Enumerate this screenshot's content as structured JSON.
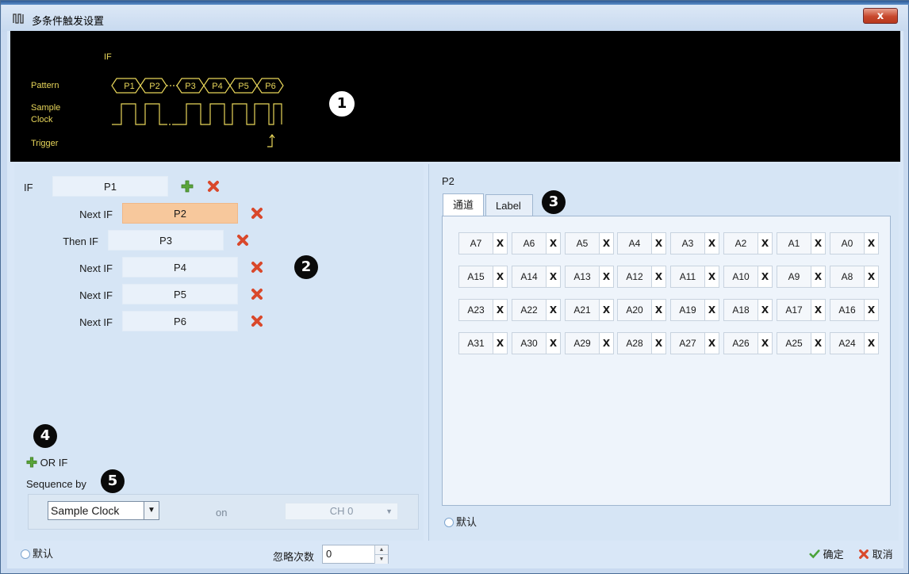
{
  "window": {
    "title": "多条件触发设置",
    "close_label": "x"
  },
  "scope": {
    "if_label": "IF",
    "pattern_label": "Pattern",
    "sample_label": "Sample",
    "clock_label": "Clock",
    "trigger_label": "Trigger",
    "patterns": [
      "P1",
      "P2",
      "P3",
      "P4",
      "P5",
      "P6"
    ],
    "mark": "1"
  },
  "conditions": [
    {
      "label": "IF",
      "value": "P1"
    },
    {
      "label": "Next IF",
      "value": "P2"
    },
    {
      "label": "Then IF",
      "value": "P3"
    },
    {
      "label": "Next IF",
      "value": "P4"
    },
    {
      "label": "Next IF",
      "value": "P5"
    },
    {
      "label": "Next IF",
      "value": "P6"
    }
  ],
  "marks": {
    "m2": "2",
    "m3": "3",
    "m4": "4",
    "m5": "5"
  },
  "or_if_label": "OR IF",
  "sequence": {
    "label": "Sequence by",
    "clock_value": "Sample Clock",
    "on_label": "on",
    "channel_value": "CH 0"
  },
  "right": {
    "selected_pattern": "P2",
    "tabs": [
      "通道",
      "Label"
    ],
    "channels": [
      [
        "A7",
        "A6",
        "A5",
        "A4",
        "A3",
        "A2",
        "A1",
        "A0"
      ],
      [
        "A15",
        "A14",
        "A13",
        "A12",
        "A11",
        "A10",
        "A9",
        "A8"
      ],
      [
        "A23",
        "A22",
        "A21",
        "A20",
        "A19",
        "A18",
        "A17",
        "A16"
      ],
      [
        "A31",
        "A30",
        "A29",
        "A28",
        "A27",
        "A26",
        "A25",
        "A24"
      ]
    ],
    "channel_state": "X",
    "default_label": "默认"
  },
  "footer": {
    "default_label": "默认",
    "ignore_label": "忽略次数",
    "ignore_value": "0",
    "ok_label": "确定",
    "cancel_label": "取消"
  }
}
